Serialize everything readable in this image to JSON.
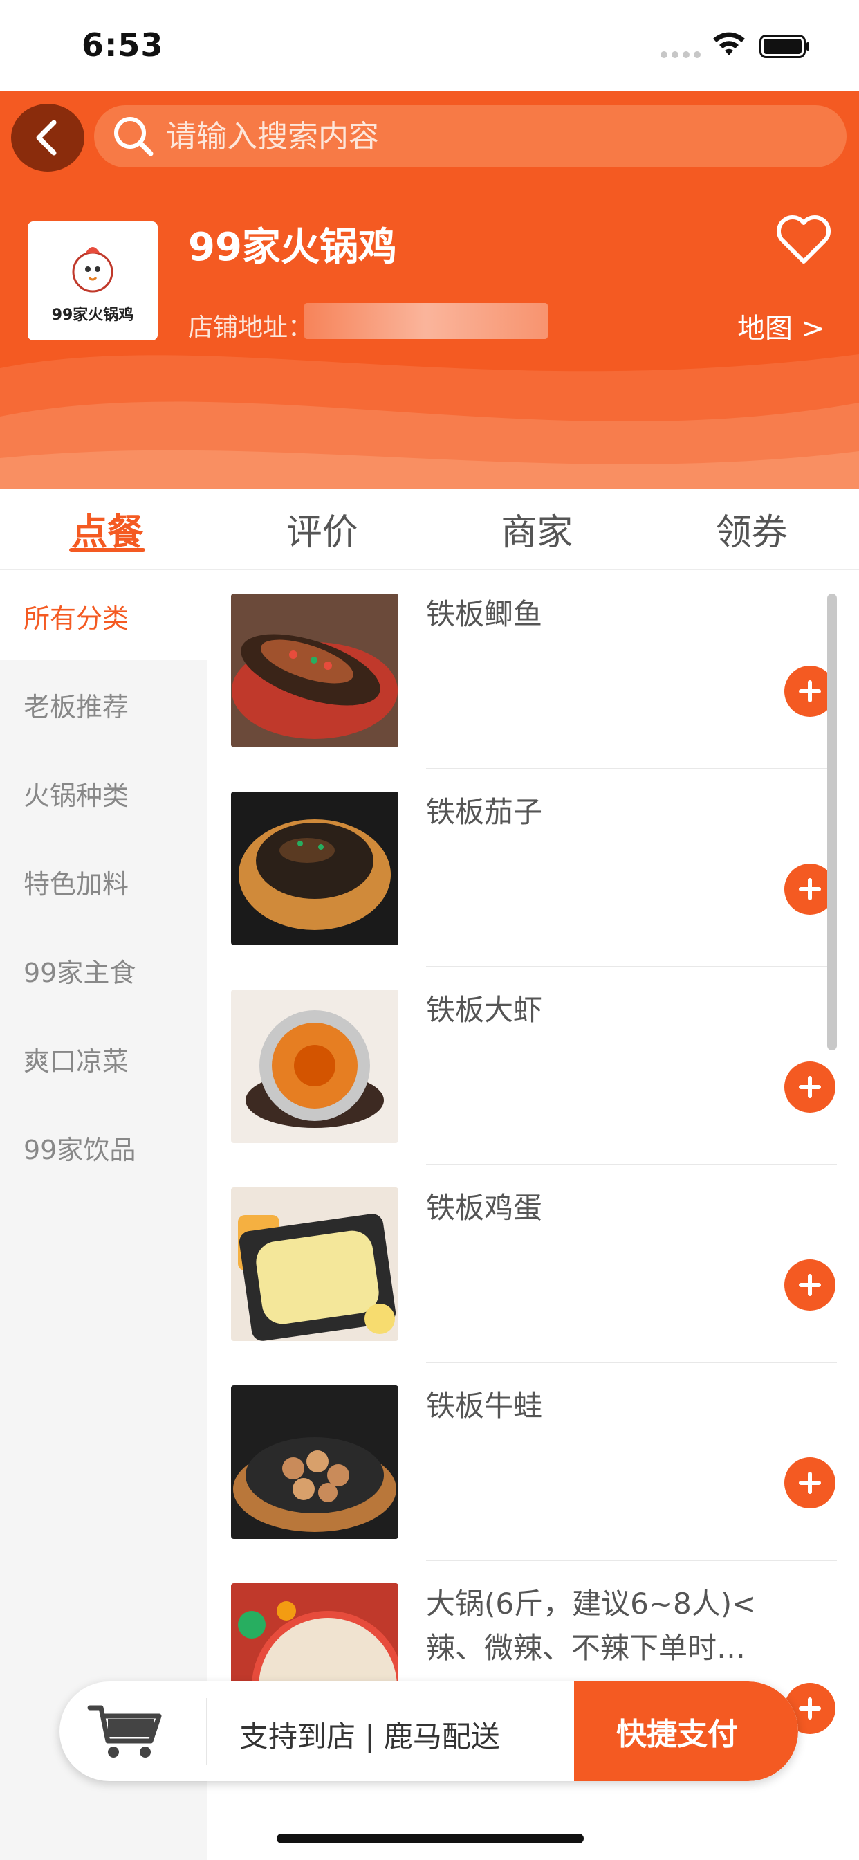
{
  "status_bar": {
    "time": "6:53"
  },
  "header": {
    "search_placeholder": "请输入搜索内容",
    "store_name": "99家火锅鸡",
    "store_address_label": "店铺地址：",
    "map_link": "地图 >",
    "logo_text": "99家火锅鸡",
    "brand_color": "#f45a22"
  },
  "tabs": [
    {
      "label": "点餐",
      "active": true
    },
    {
      "label": "评价",
      "active": false
    },
    {
      "label": "商家",
      "active": false
    },
    {
      "label": "领券",
      "active": false
    }
  ],
  "categories": [
    {
      "label": "所有分类",
      "active": true
    },
    {
      "label": "老板推荐",
      "active": false
    },
    {
      "label": "火锅种类",
      "active": false
    },
    {
      "label": "特色加料",
      "active": false
    },
    {
      "label": "99家主食",
      "active": false
    },
    {
      "label": "爽口凉菜",
      "active": false
    },
    {
      "label": "99家饮品",
      "active": false
    }
  ],
  "menu_items": [
    {
      "name": "铁板鲫鱼",
      "image": "fish-dish"
    },
    {
      "name": "铁板茄子",
      "image": "eggplant-dish"
    },
    {
      "name": "铁板大虾",
      "image": "shrimp-dish"
    },
    {
      "name": "铁板鸡蛋",
      "image": "egg-dish"
    },
    {
      "name": "铁板牛蛙",
      "image": "bullfrog-dish"
    },
    {
      "name": "大锅(6斤，建议6~8人)<辣、微辣、不辣下单时…",
      "image": "hotpot-dish"
    }
  ],
  "cart_bar": {
    "delivery_text": "支持到店 | 鹿马配送",
    "pay_button": "快捷支付",
    "icon": "cart-icon"
  }
}
